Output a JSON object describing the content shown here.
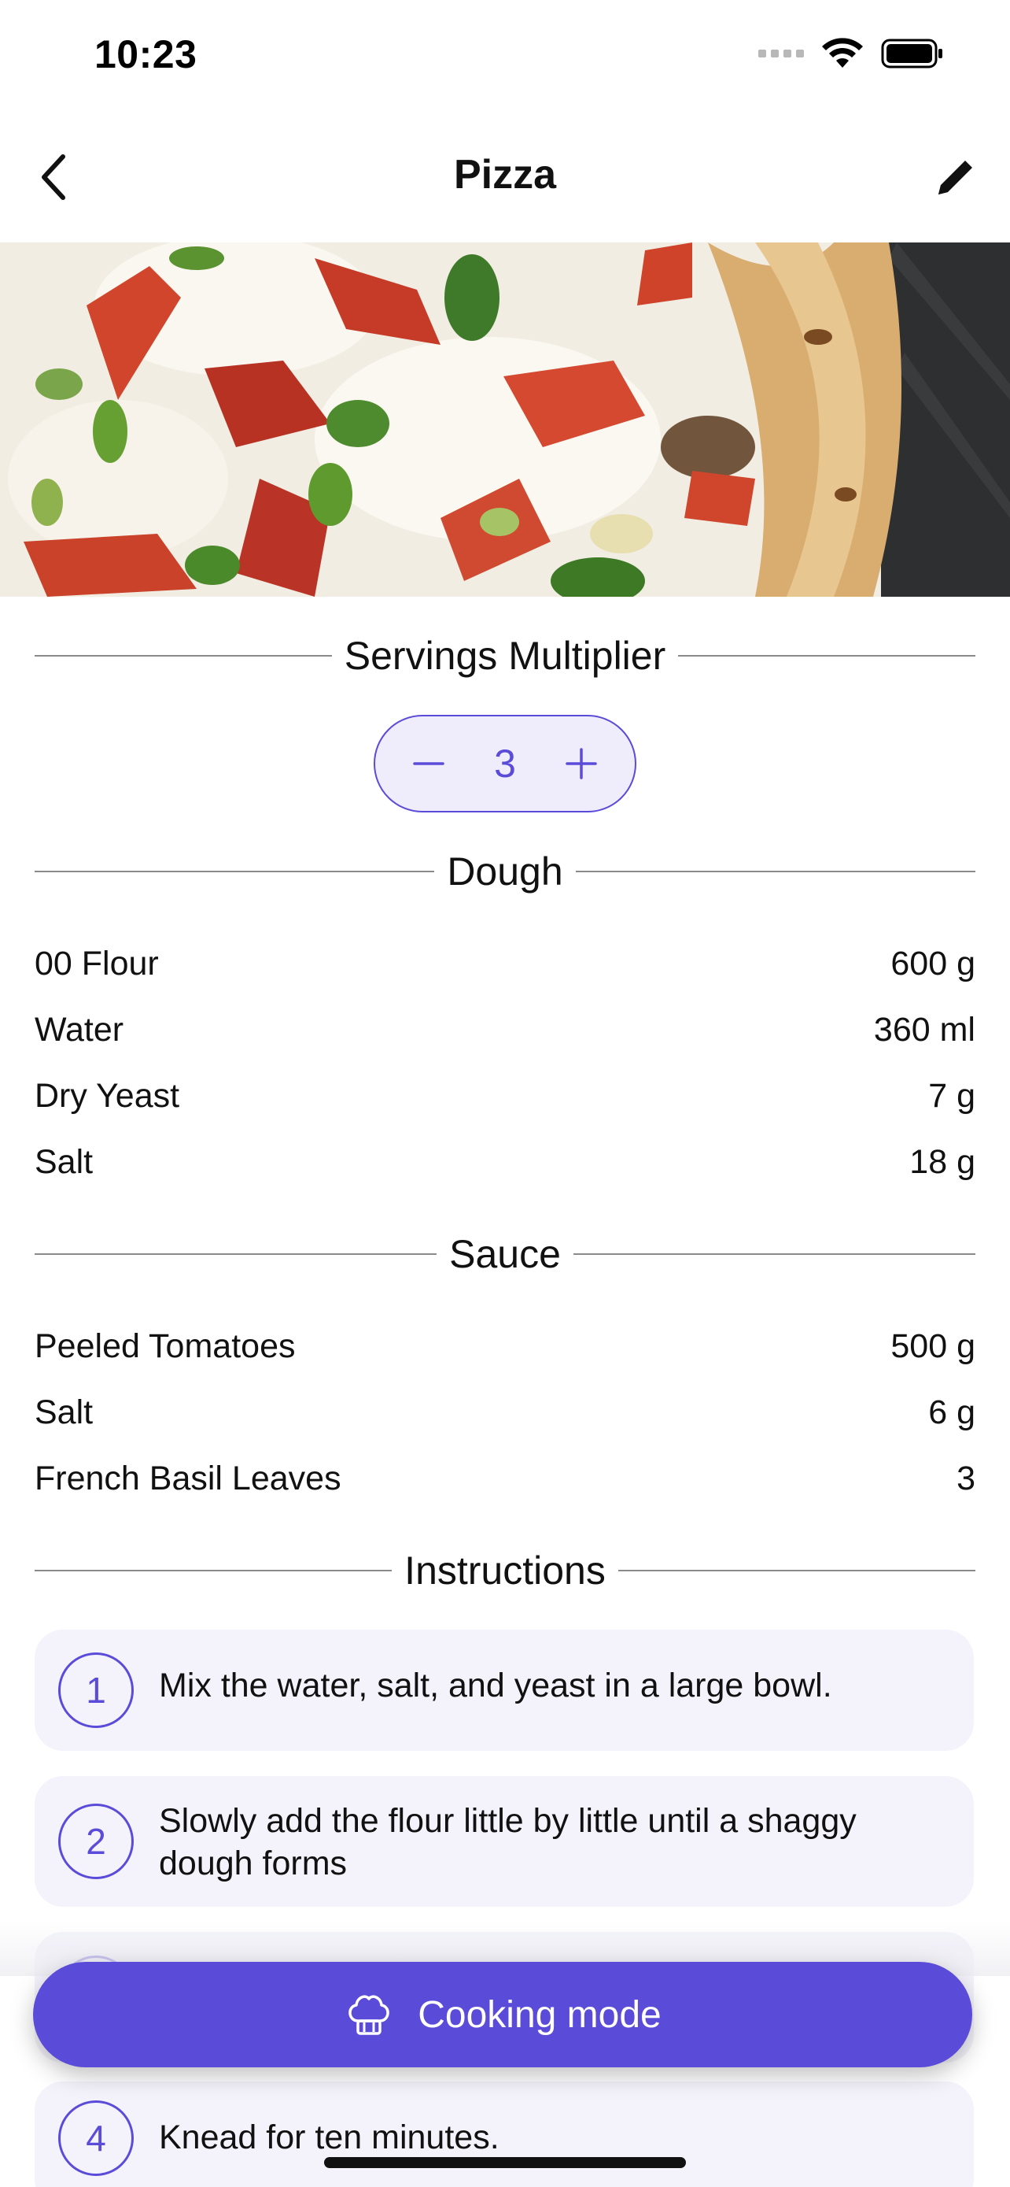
{
  "status_bar": {
    "time": "10:23"
  },
  "nav": {
    "title": "Pizza",
    "back_icon": "chevron-left-icon",
    "edit_icon": "pencil-icon"
  },
  "servings": {
    "label": "Servings Multiplier",
    "value": "3"
  },
  "sections": {
    "dough": {
      "title": "Dough",
      "items": [
        {
          "name": "00 Flour",
          "amount": "600 g"
        },
        {
          "name": "Water",
          "amount": "360 ml"
        },
        {
          "name": "Dry Yeast",
          "amount": "7 g"
        },
        {
          "name": "Salt",
          "amount": "18 g"
        }
      ]
    },
    "sauce": {
      "title": "Sauce",
      "items": [
        {
          "name": "Peeled Tomatoes",
          "amount": "500 g"
        },
        {
          "name": "Salt",
          "amount": "6 g"
        },
        {
          "name": "French Basil Leaves",
          "amount": "3"
        }
      ]
    }
  },
  "instructions": {
    "title": "Instructions",
    "steps": [
      {
        "number": "1",
        "text": "Mix the water, salt, and yeast in a large bowl."
      },
      {
        "number": "2",
        "text": "Slowly add the flour little by little until a shaggy dough forms"
      },
      {
        "number": "4",
        "text": "Knead for ten minutes."
      }
    ]
  },
  "cooking_mode": {
    "label": "Cooking mode",
    "icon": "chef-hat-icon"
  },
  "colors": {
    "accent": "#5b4bd9",
    "card_bg": "#f4f3fb",
    "stepper_bg": "#efedfb"
  }
}
